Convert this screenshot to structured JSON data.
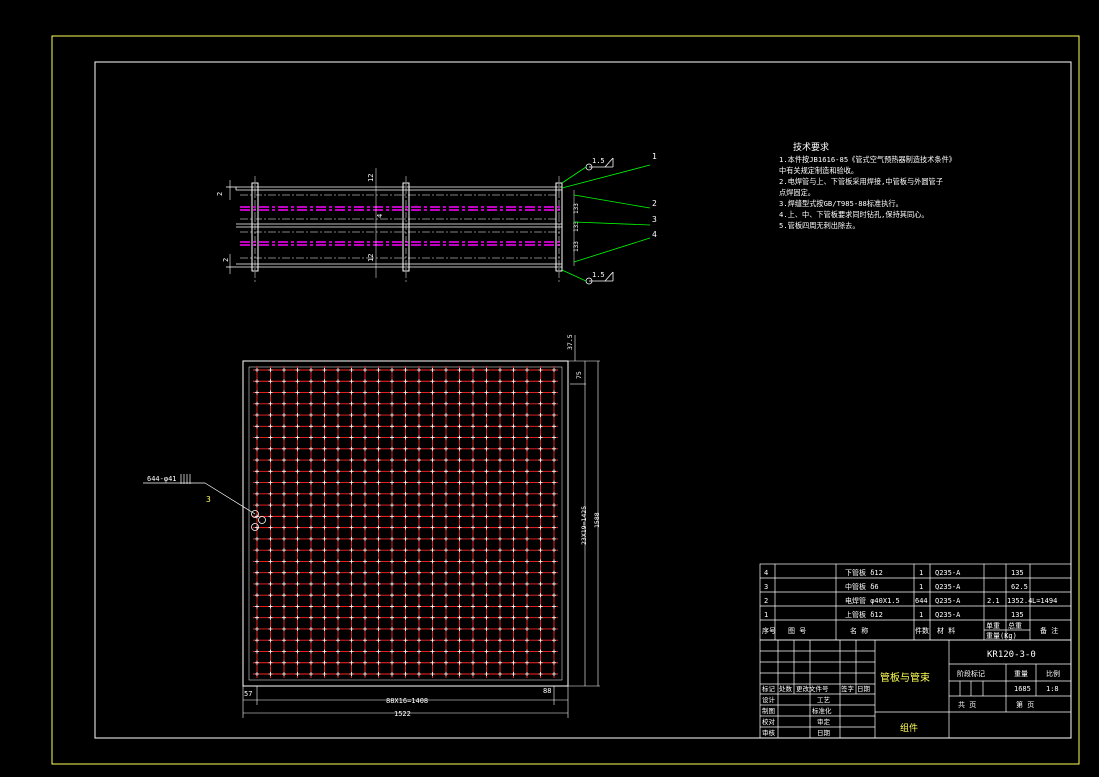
{
  "drawing": {
    "colors": {
      "border": "#ffff55",
      "line": "#ffffff",
      "leader": "#00ff00",
      "tube_plate": "#ff00ff",
      "tube": "#ff2222",
      "text": "#ffffff",
      "text_yellow": "#ffff55"
    },
    "tech_notes": {
      "heading": "技术要求",
      "lines": [
        "1.本件按JB1616-85《管式空气预热器制造技术条件》",
        "  中有关规定制造和验收。",
        "2.电焊管与上、下管板采用焊接,中管板与外圆管子",
        "  点焊固定。",
        "3.焊缝型式按GB/T985-88标准执行。",
        "4.上、中、下管板要求同时钻孔,保持其同心。",
        "5.管板四周无刺出除去。"
      ]
    },
    "elevation": {
      "callouts": [
        "1",
        "2",
        "3",
        "4"
      ],
      "weld_top": "1.5",
      "weld_bottom": "1.5",
      "left_dim_top": "2",
      "left_dim_bottom": "2",
      "mid_dim_top": "12",
      "mid_dim_mid": "4",
      "mid_dim_bottom": "12",
      "right_dims": [
        "133",
        "133",
        "133"
      ]
    },
    "plan": {
      "hole_label": "644-φ41",
      "weld_symbol": "3",
      "dim_top_right": "37.5",
      "dim_right_small": "75",
      "dim_right_inner": "23X19=1425",
      "dim_right_outer": "1588",
      "dim_bottom_left": "57",
      "dim_bottom_right": "88",
      "dim_bottom_inner": "88X16=1408",
      "dim_bottom_outer": "1522",
      "tube_rows": 28,
      "tube_cols": 23
    },
    "bom": {
      "rows": [
        {
          "no": "4",
          "drawing": "",
          "name": "下管板 δ12",
          "qty": "1",
          "material": "Q235-A",
          "unit_wt": "",
          "total_wt": "135",
          "remark": ""
        },
        {
          "no": "3",
          "drawing": "",
          "name": "中管板 δ6",
          "qty": "1",
          "material": "Q235-A",
          "unit_wt": "",
          "total_wt": "62.5",
          "remark": ""
        },
        {
          "no": "2",
          "drawing": "",
          "name": "电焊管 φ40X1.5",
          "qty": "644",
          "material": "Q235-A",
          "unit_wt": "2.1",
          "total_wt": "1352.4",
          "remark": "L=1494"
        },
        {
          "no": "1",
          "drawing": "",
          "name": "上管板 δ12",
          "qty": "1",
          "material": "Q235-A",
          "unit_wt": "",
          "total_wt": "135",
          "remark": ""
        }
      ],
      "header": {
        "no": "序号",
        "drawing": "图  号",
        "name": "名    称",
        "qty": "件数",
        "material": "材  料",
        "unit_wt": "单重",
        "total_wt": "总重",
        "wt_unit": "重量(Kg)",
        "remark": "备  注"
      }
    },
    "title_block": {
      "drawing_no": "KR120-3-0",
      "title": "管板与管束",
      "stage_label": "阶段标记",
      "weight_label": "重量",
      "scale_label": "比例",
      "weight": "1685",
      "scale": "1:8",
      "sheets_total": "共    页",
      "sheet_no": "第    页",
      "kind": "组件",
      "rev_headers": [
        "标记",
        "处数",
        "更改文件号",
        "签字",
        "日期"
      ],
      "roles": [
        "设计",
        "制图",
        "校对",
        "审核"
      ],
      "roles2": [
        "工艺",
        "标准化",
        "审定",
        "日期"
      ]
    }
  }
}
